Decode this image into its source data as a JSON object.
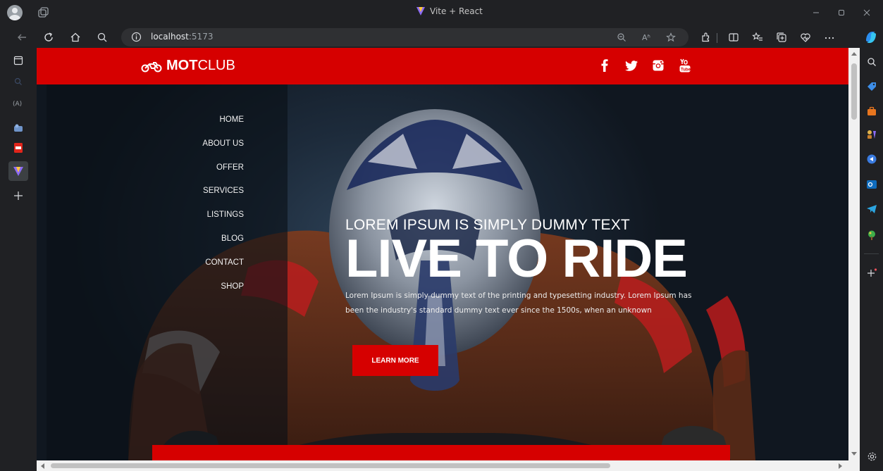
{
  "browser": {
    "window_title": "Vite + React",
    "url_host": "localhost",
    "url_port": ":5173",
    "read_aloud_label": "Aʱ"
  },
  "site": {
    "brand_bold": "MOT",
    "brand_light": "CLUB",
    "social": [
      "facebook-icon",
      "twitter-icon",
      "instagram-icon",
      "youtube-icon"
    ],
    "accent_color": "#d60000"
  },
  "menu": {
    "items": [
      "HOME",
      "ABOUT US",
      "OFFER",
      "SERVICES",
      "LISTINGS",
      "BLOG",
      "CONTACT",
      "SHOP"
    ]
  },
  "hero": {
    "subtitle": "LOREM IPSUM IS SIMPLY DUMMY TEXT",
    "title": "LIVE TO RIDE",
    "paragraph": "Lorem Ipsum is simply dummy text of the printing and typesetting industry. Lorem Ipsum has been the industry's standard dummy text ever since the 1500s, when an unknown",
    "button_label": "LEARN MORE"
  }
}
